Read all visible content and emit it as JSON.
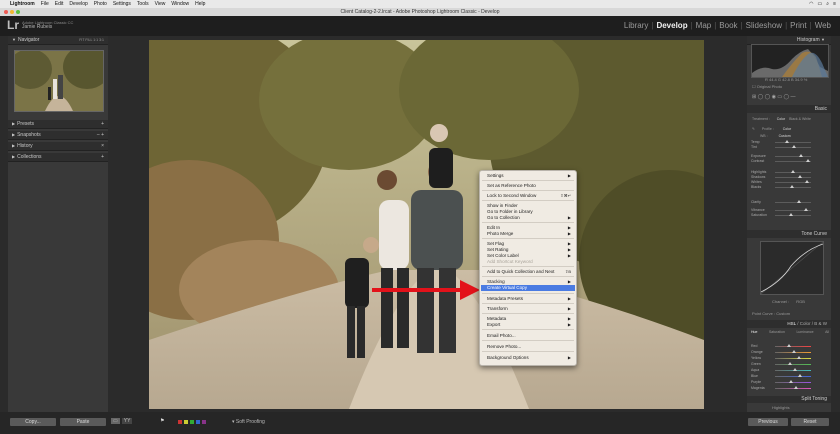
{
  "menubar": {
    "items": [
      "Lightroom",
      "File",
      "Edit",
      "Develop",
      "Photo",
      "Settings",
      "Tools",
      "View",
      "Window",
      "Help"
    ]
  },
  "window": {
    "title": "Client Catalog-2-2.lrcat - Adobe Photoshop Lightroom Classic - Develop"
  },
  "identity": {
    "logo": "Lr",
    "line1": "Adobe Lightroom Classic CC",
    "line2": "Jamie Rubeis"
  },
  "modules": [
    "Library",
    "Develop",
    "Map",
    "Book",
    "Slideshow",
    "Print",
    "Web"
  ],
  "active_module": "Develop",
  "left_panel": {
    "navigator": "Navigator",
    "zoom_options": [
      "FIT",
      "FILL",
      "1:1",
      "3:1"
    ],
    "sections": [
      "Presets",
      "Snapshots",
      "History",
      "Collections"
    ]
  },
  "right_panel": {
    "histogram": "Histogram",
    "histogram_readout": "R 44.4   G 42.8   B 34.9 %",
    "original_photo": "Original Photo",
    "basic": "Basic",
    "treatment": [
      "Treatment :",
      "Color",
      "Black & White"
    ],
    "profile_label": "Profile :",
    "profile_value": "Color",
    "wb_label": "WB :",
    "wb_value": "Custom",
    "basic_sliders": [
      "Temp",
      "Tint",
      "Exposure",
      "Contrast",
      "Highlights",
      "Shadows",
      "Whites",
      "Blacks",
      "Clarity",
      "Vibrance",
      "Saturation"
    ],
    "tone_curve": "Tone Curve",
    "tone_channel": "Channel :",
    "tone_channel_value": "RGB",
    "point_curve": "Point Curve :",
    "point_curve_value": "Custom",
    "hsl_tabs": [
      "HSL",
      "Color",
      "B & W"
    ],
    "hsl_subtabs": [
      "Hue",
      "Saturation",
      "Luminance",
      "All"
    ],
    "hsl_colors": [
      "Red",
      "Orange",
      "Yellow",
      "Green",
      "Aqua",
      "Blue",
      "Purple",
      "Magenta"
    ],
    "split_toning": "Split Toning",
    "highlights": "Highlights"
  },
  "toolbar": {
    "copy": "Copy...",
    "paste": "Paste",
    "soft_proofing": "Soft Proofing",
    "previous": "Previous",
    "reset": "Reset"
  },
  "context_menu": {
    "items": [
      {
        "label": "Settings",
        "submenu": true
      },
      {
        "label": "Set as Reference Photo"
      },
      {
        "label": "Lock to Second Window",
        "shortcut": "⇧⌘↵"
      },
      {
        "label": "Show in Finder"
      },
      {
        "label": "Go to Folder in Library"
      },
      {
        "label": "Go to Collection",
        "submenu": true
      },
      {
        "label": "Edit In",
        "submenu": true
      },
      {
        "label": "Photo Merge",
        "submenu": true
      },
      {
        "label": "Set Flag",
        "submenu": true
      },
      {
        "label": "Set Rating",
        "submenu": true
      },
      {
        "label": "Set Color Label",
        "submenu": true
      },
      {
        "label": "Add Shortcut Keyword",
        "disabled": true
      },
      {
        "label": "Add to Quick Collection and Next",
        "shortcut": "⇧B"
      },
      {
        "label": "Stacking",
        "submenu": true
      },
      {
        "label": "Create Virtual Copy",
        "highlighted": true
      },
      {
        "label": "Metadata Presets",
        "submenu": true
      },
      {
        "label": "Transform",
        "submenu": true
      },
      {
        "label": "Metadata",
        "submenu": true
      },
      {
        "label": "Export",
        "submenu": true
      },
      {
        "label": "Email Photo..."
      },
      {
        "label": "Remove Photo..."
      },
      {
        "label": "Background Options",
        "submenu": true
      }
    ]
  },
  "colors": {
    "accent_arrow": "#e3121a",
    "highlight": "#4a7be2",
    "panel": "#393939"
  }
}
